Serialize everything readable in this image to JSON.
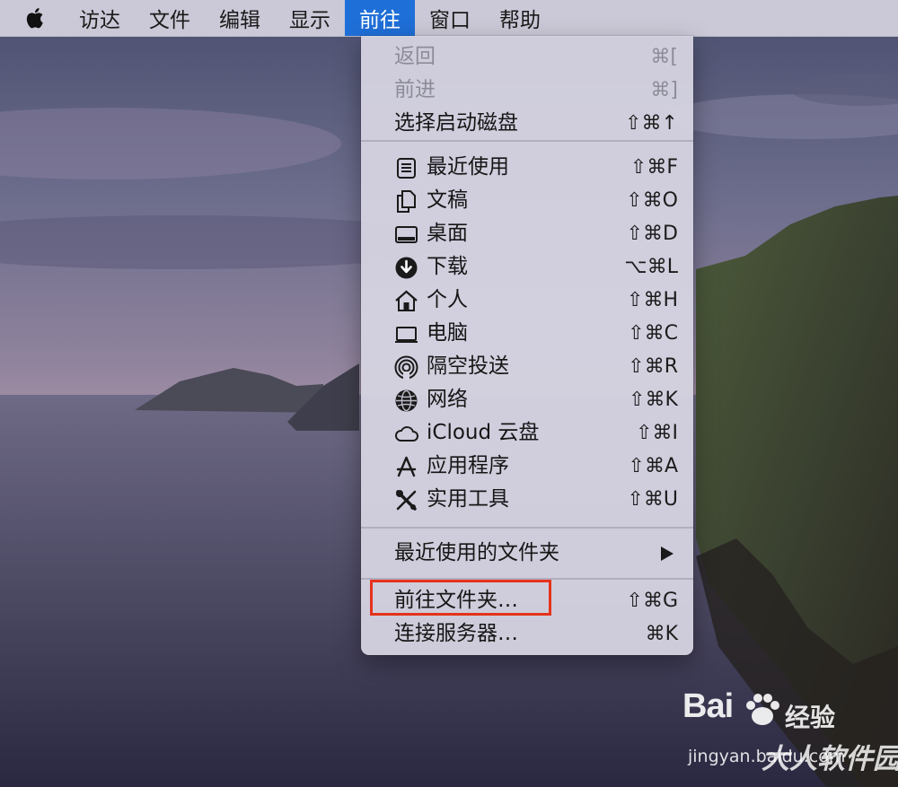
{
  "menubar": {
    "apple_icon": "apple-logo-icon",
    "items": [
      {
        "label": "访达",
        "active": false
      },
      {
        "label": "文件",
        "active": false
      },
      {
        "label": "编辑",
        "active": false
      },
      {
        "label": "显示",
        "active": false
      },
      {
        "label": "前往",
        "active": true
      },
      {
        "label": "窗口",
        "active": false
      },
      {
        "label": "帮助",
        "active": false
      }
    ],
    "active_color": "#1f6fd8"
  },
  "go_menu": {
    "navigation": [
      {
        "label": "返回",
        "shortcut": "⌘[",
        "enabled": false
      },
      {
        "label": "前进",
        "shortcut": "⌘]",
        "enabled": false
      },
      {
        "label": "选择启动磁盘",
        "shortcut": "⇧⌘↑",
        "enabled": true
      }
    ],
    "places": [
      {
        "label": "最近使用",
        "shortcut": "⇧⌘F",
        "icon": "recents-icon"
      },
      {
        "label": "文稿",
        "shortcut": "⇧⌘O",
        "icon": "documents-icon"
      },
      {
        "label": "桌面",
        "shortcut": "⇧⌘D",
        "icon": "desktop-icon"
      },
      {
        "label": "下载",
        "shortcut": "⌥⌘L",
        "icon": "downloads-icon"
      },
      {
        "label": "个人",
        "shortcut": "⇧⌘H",
        "icon": "home-icon"
      },
      {
        "label": "电脑",
        "shortcut": "⇧⌘C",
        "icon": "computer-icon"
      },
      {
        "label": "隔空投送",
        "shortcut": "⇧⌘R",
        "icon": "airdrop-icon"
      },
      {
        "label": "网络",
        "shortcut": "⇧⌘K",
        "icon": "network-icon"
      },
      {
        "label": "iCloud 云盘",
        "shortcut": "⇧⌘I",
        "icon": "icloud-icon"
      },
      {
        "label": "应用程序",
        "shortcut": "⇧⌘A",
        "icon": "applications-icon"
      },
      {
        "label": "实用工具",
        "shortcut": "⇧⌘U",
        "icon": "utilities-icon"
      }
    ],
    "recent_folders": {
      "label": "最近使用的文件夹",
      "submenu_icon": "chevron-right-icon"
    },
    "folder_actions": [
      {
        "label": "前往文件夹…",
        "shortcut": "⇧⌘G",
        "highlighted": true
      },
      {
        "label": "连接服务器…",
        "shortcut": "⌘K",
        "highlighted": false
      }
    ],
    "highlight_color": "#e5321c"
  },
  "watermark": {
    "logo": "Bai",
    "logo_suffix": "经验",
    "url": "jingyan.baidu.com",
    "site": "大人软件园"
  }
}
